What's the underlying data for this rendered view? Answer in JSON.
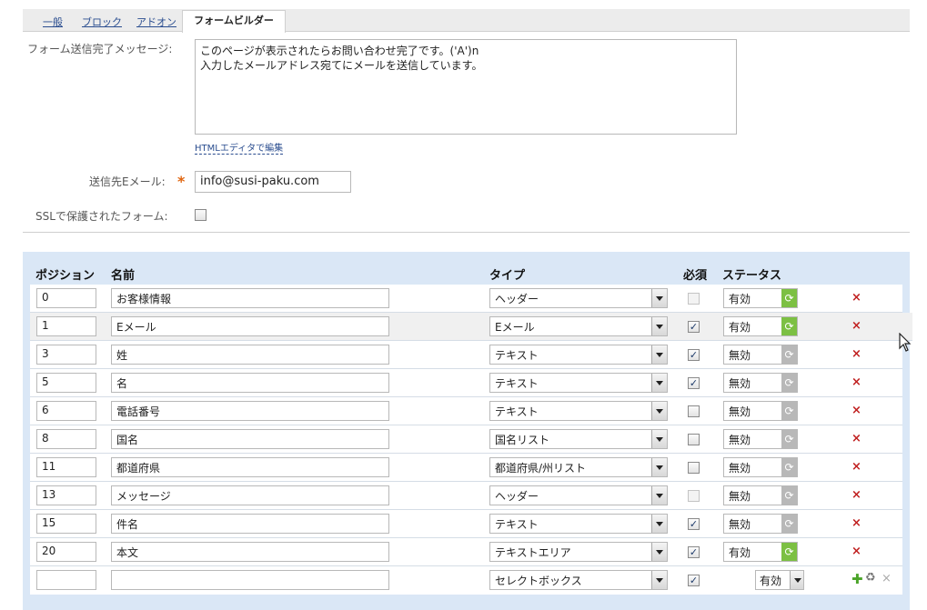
{
  "tabs": {
    "items": [
      "一般",
      "ブロック",
      "アドオン"
    ],
    "active": "フォームビルダー"
  },
  "form": {
    "message_label": "フォーム送信完了メッセージ:",
    "message_lines": [
      "このページが表示されたらお問い合わせ完了です。('A')n",
      "入力したメールアドレス宛てにメールを送信しています。"
    ],
    "html_edit_link": "HTMLエディタで編集",
    "email_label": "送信先Eメール:",
    "email_required_mark": "*",
    "email_value": "info@susi-paku.com",
    "ssl_label": "SSLで保護されたフォーム:"
  },
  "grid": {
    "headers": {
      "position": "ポジション",
      "name": "名前",
      "type": "タイプ",
      "required": "必須",
      "status": "ステータス"
    },
    "rows": [
      {
        "position": "0",
        "name": "お客様情報",
        "type": "ヘッダー",
        "required": false,
        "required_disabled": true,
        "status": "有効",
        "active": true
      },
      {
        "position": "1",
        "name": "Eメール",
        "type": "Eメール",
        "required": true,
        "required_disabled": false,
        "status": "有効",
        "active": true
      },
      {
        "position": "3",
        "name": "姓",
        "type": "テキスト",
        "required": true,
        "required_disabled": false,
        "status": "無効",
        "active": false
      },
      {
        "position": "5",
        "name": "名",
        "type": "テキスト",
        "required": true,
        "required_disabled": false,
        "status": "無効",
        "active": false
      },
      {
        "position": "6",
        "name": "電話番号",
        "type": "テキスト",
        "required": false,
        "required_disabled": false,
        "status": "無効",
        "active": false
      },
      {
        "position": "8",
        "name": "国名",
        "type": "国名リスト",
        "required": false,
        "required_disabled": false,
        "status": "無効",
        "active": false
      },
      {
        "position": "11",
        "name": "都道府県",
        "type": "都道府県/州リスト",
        "required": false,
        "required_disabled": false,
        "status": "無効",
        "active": false
      },
      {
        "position": "13",
        "name": "メッセージ",
        "type": "ヘッダー",
        "required": false,
        "required_disabled": true,
        "status": "無効",
        "active": false
      },
      {
        "position": "15",
        "name": "件名",
        "type": "テキスト",
        "required": true,
        "required_disabled": false,
        "status": "無効",
        "active": false
      },
      {
        "position": "20",
        "name": "本文",
        "type": "テキストエリア",
        "required": true,
        "required_disabled": false,
        "status": "有効",
        "active": true
      }
    ],
    "new_row": {
      "position": "",
      "name": "",
      "type": "セレクトボックス",
      "required": true,
      "status": "有効"
    }
  },
  "icons": {
    "delete": "×",
    "add": "✚",
    "refresh": "⟳",
    "recycle": "♻"
  },
  "colors": {
    "active_refresh": "#7cc043",
    "inactive_refresh": "#b8b8b8",
    "delete": "#c02020",
    "add": "#4aa428",
    "required_star": "#e0650f",
    "grid_bg": "#dae7f6"
  }
}
